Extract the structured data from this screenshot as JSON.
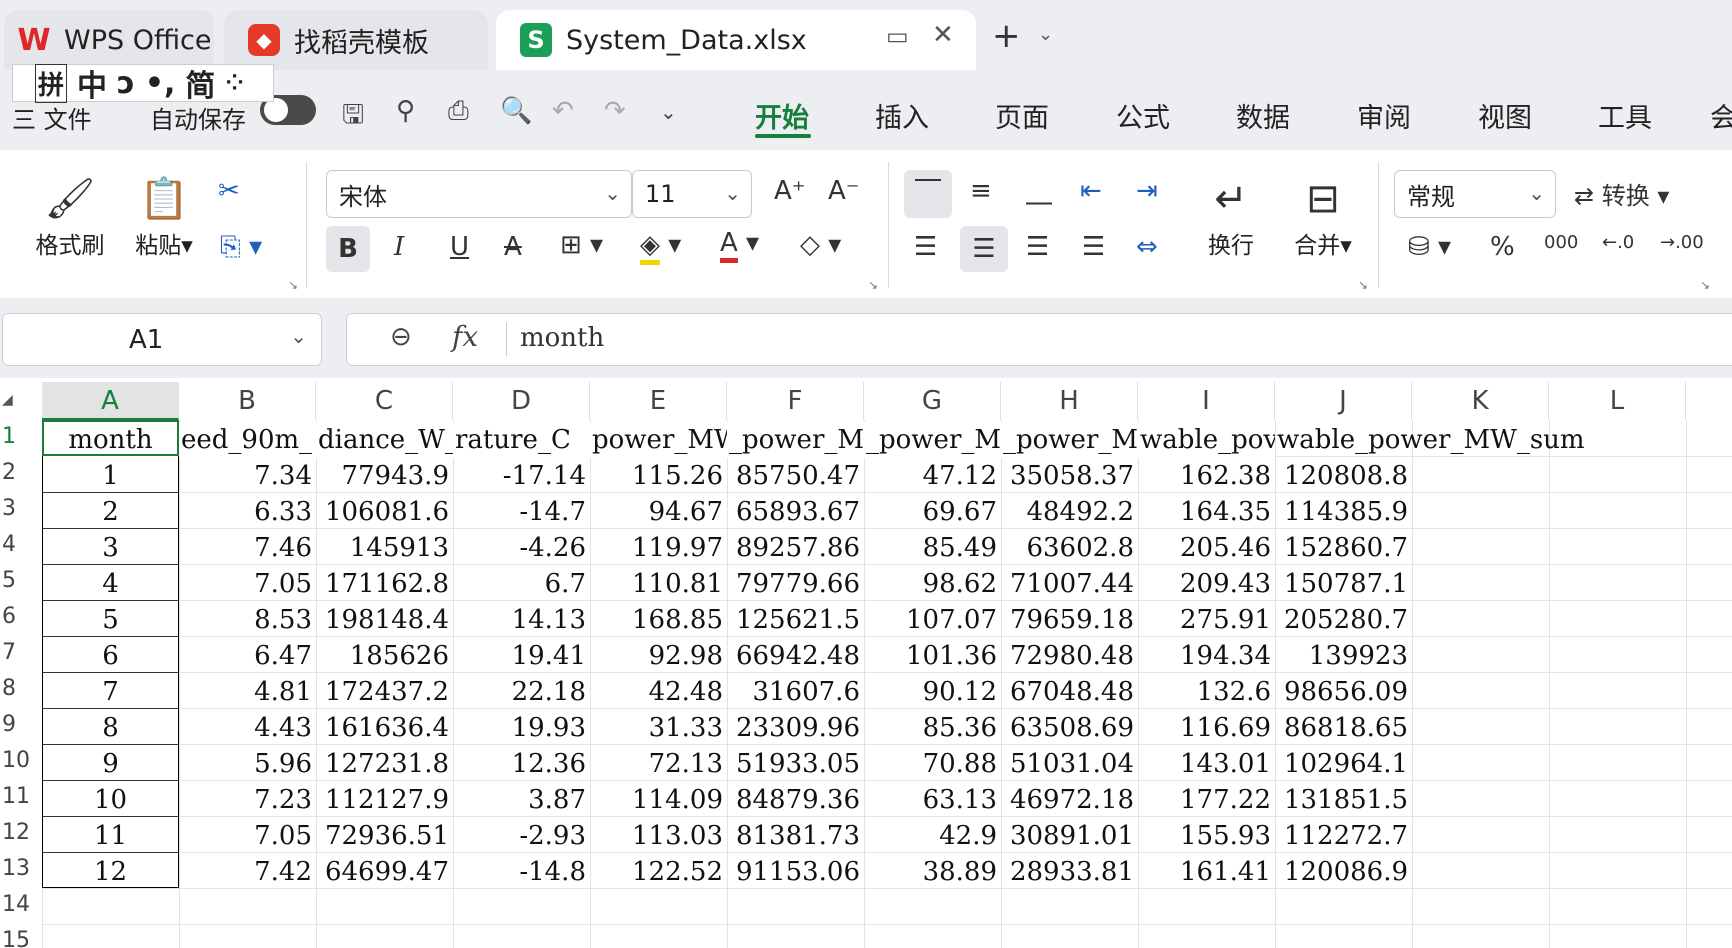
{
  "titlebar": {
    "tabs": [
      {
        "label": "WPS Office"
      },
      {
        "label": "找稻壳模板"
      },
      {
        "label": "System_Data.xlsx"
      }
    ],
    "new_tab": "+",
    "ime": [
      "拼",
      "中",
      "ɔ",
      "•,",
      "简",
      "⁘"
    ]
  },
  "menubar": {
    "file_label": "三 文件",
    "autosave_label": "自动保存",
    "tabs": [
      "开始",
      "插入",
      "页面",
      "公式",
      "数据",
      "审阅",
      "视图",
      "工具",
      "会"
    ],
    "active_tab": "开始"
  },
  "ribbon": {
    "format_painter": "格式刷",
    "paste": "粘贴",
    "font_name": "宋体",
    "font_size": "11",
    "wrap": "换行",
    "merge": "合并",
    "number_format": "常规",
    "convert": "转换",
    "percent": "%",
    "thousands": "000"
  },
  "formula_bar": {
    "name_box": "A1",
    "fx": "fx",
    "content": "month"
  },
  "sheet": {
    "columns": [
      "A",
      "B",
      "C",
      "D",
      "E",
      "F",
      "G",
      "H",
      "I",
      "J",
      "K",
      "L"
    ],
    "row_numbers": [
      "1",
      "2",
      "3",
      "4",
      "5",
      "6",
      "7",
      "8",
      "9",
      "10",
      "11",
      "12",
      "13",
      "14",
      "15"
    ],
    "header_row": [
      "month",
      "eed_90m_",
      "diance_W_",
      "rature_C",
      "power_MW",
      "_power_MW",
      "_power_MW",
      "_power_M",
      "wable_pov",
      "wable_power_MW_sum"
    ],
    "rows": [
      [
        "1",
        "7.34",
        "77943.9",
        "-17.14",
        "115.26",
        "85750.47",
        "47.12",
        "35058.37",
        "162.38",
        "120808.8"
      ],
      [
        "2",
        "6.33",
        "106081.6",
        "-14.7",
        "94.67",
        "65893.67",
        "69.67",
        "48492.2",
        "164.35",
        "114385.9"
      ],
      [
        "3",
        "7.46",
        "145913",
        "-4.26",
        "119.97",
        "89257.86",
        "85.49",
        "63602.8",
        "205.46",
        "152860.7"
      ],
      [
        "4",
        "7.05",
        "171162.8",
        "6.7",
        "110.81",
        "79779.66",
        "98.62",
        "71007.44",
        "209.43",
        "150787.1"
      ],
      [
        "5",
        "8.53",
        "198148.4",
        "14.13",
        "168.85",
        "125621.5",
        "107.07",
        "79659.18",
        "275.91",
        "205280.7"
      ],
      [
        "6",
        "6.47",
        "185626",
        "19.41",
        "92.98",
        "66942.48",
        "101.36",
        "72980.48",
        "194.34",
        "139923"
      ],
      [
        "7",
        "4.81",
        "172437.2",
        "22.18",
        "42.48",
        "31607.6",
        "90.12",
        "67048.48",
        "132.6",
        "98656.09"
      ],
      [
        "8",
        "4.43",
        "161636.4",
        "19.93",
        "31.33",
        "23309.96",
        "85.36",
        "63508.69",
        "116.69",
        "86818.65"
      ],
      [
        "9",
        "5.96",
        "127231.8",
        "12.36",
        "72.13",
        "51933.05",
        "70.88",
        "51031.04",
        "143.01",
        "102964.1"
      ],
      [
        "10",
        "7.23",
        "112127.9",
        "3.87",
        "114.09",
        "84879.36",
        "63.13",
        "46972.18",
        "177.22",
        "131851.5"
      ],
      [
        "11",
        "7.05",
        "72936.51",
        "-2.93",
        "113.03",
        "81381.73",
        "42.9",
        "30891.01",
        "155.93",
        "112272.7"
      ],
      [
        "12",
        "7.42",
        "64699.47",
        "-14.8",
        "122.52",
        "91153.06",
        "38.89",
        "28933.81",
        "161.41",
        "120086.9"
      ]
    ]
  },
  "colors": {
    "accent": "#157f3c",
    "brand_red": "#e0262a",
    "excel_green": "#1b9e55"
  }
}
